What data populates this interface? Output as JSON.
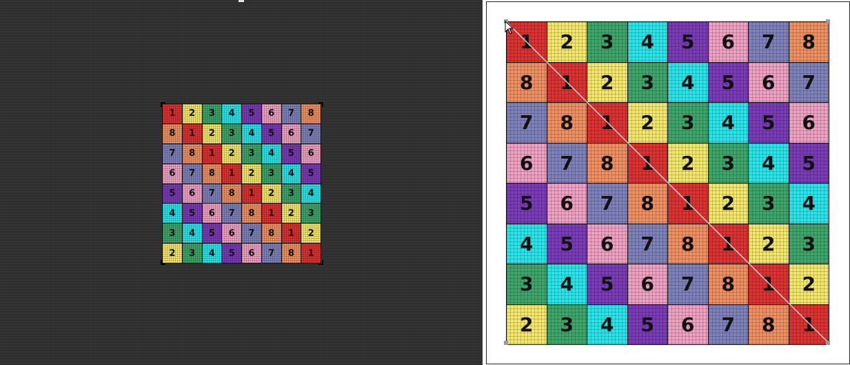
{
  "colors": {
    "1": "#db3232",
    "2": "#f3e76c",
    "3": "#3ea66a",
    "4": "#2ae4ea",
    "5": "#7a3bb6",
    "6": "#eea1c2",
    "7": "#7f82ba",
    "8": "#ef9062"
  },
  "grid": [
    [
      "1",
      "2",
      "3",
      "4",
      "5",
      "6",
      "7",
      "8"
    ],
    [
      "8",
      "1",
      "2",
      "3",
      "4",
      "5",
      "6",
      "7"
    ],
    [
      "7",
      "8",
      "1",
      "2",
      "3",
      "4",
      "5",
      "6"
    ],
    [
      "6",
      "7",
      "8",
      "1",
      "2",
      "3",
      "4",
      "5"
    ],
    [
      "5",
      "6",
      "7",
      "8",
      "1",
      "2",
      "3",
      "4"
    ],
    [
      "4",
      "5",
      "6",
      "7",
      "8",
      "1",
      "2",
      "3"
    ],
    [
      "3",
      "4",
      "5",
      "6",
      "7",
      "8",
      "1",
      "2"
    ],
    [
      "2",
      "3",
      "4",
      "5",
      "6",
      "7",
      "8",
      "1"
    ]
  ],
  "icons": {
    "cursor": "mouse-pointer-icon"
  }
}
